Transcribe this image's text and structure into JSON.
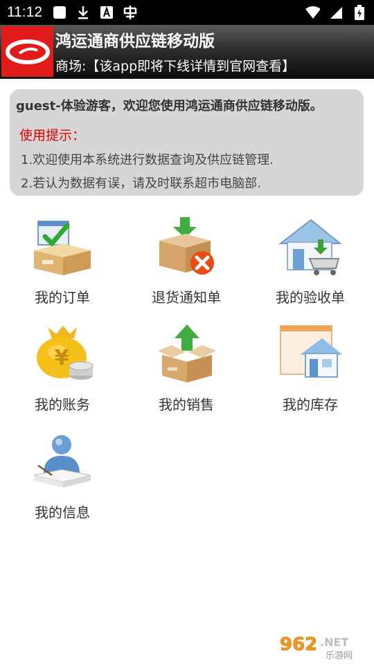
{
  "status_bar": {
    "time": "11:12",
    "icons": [
      "notification-square-icon",
      "download-icon",
      "a-icon",
      "app-icon",
      "wifi-icon",
      "signal-icon",
      "battery-icon"
    ]
  },
  "header": {
    "title": "鸿运通商供应链移动版",
    "subtitle": "商场:【该app即将下线详情到官网查看】",
    "logo_color": "#e11a1a"
  },
  "welcome": {
    "greeting": "guest-体验游客，欢迎您使用鸿运通商供应链移动版。",
    "tips_title": "使用提示：",
    "tips": [
      "1.欢迎使用本系统进行数据查询及供应链管理.",
      "2.若认为数据有误，请及时联系超市电脑部."
    ]
  },
  "menu": [
    {
      "label": "我的订单",
      "icon": "order-box-check-icon"
    },
    {
      "label": "退货通知单",
      "icon": "return-box-x-icon"
    },
    {
      "label": "我的验收单",
      "icon": "house-cart-icon"
    },
    {
      "label": "我的账务",
      "icon": "money-bag-coins-icon"
    },
    {
      "label": "我的销售",
      "icon": "box-arrow-up-icon"
    },
    {
      "label": "我的库存",
      "icon": "house-window-icon"
    },
    {
      "label": "我的信息",
      "icon": "user-book-icon"
    }
  ],
  "watermark": {
    "brand": "962.NET",
    "sub": "乐游网"
  }
}
